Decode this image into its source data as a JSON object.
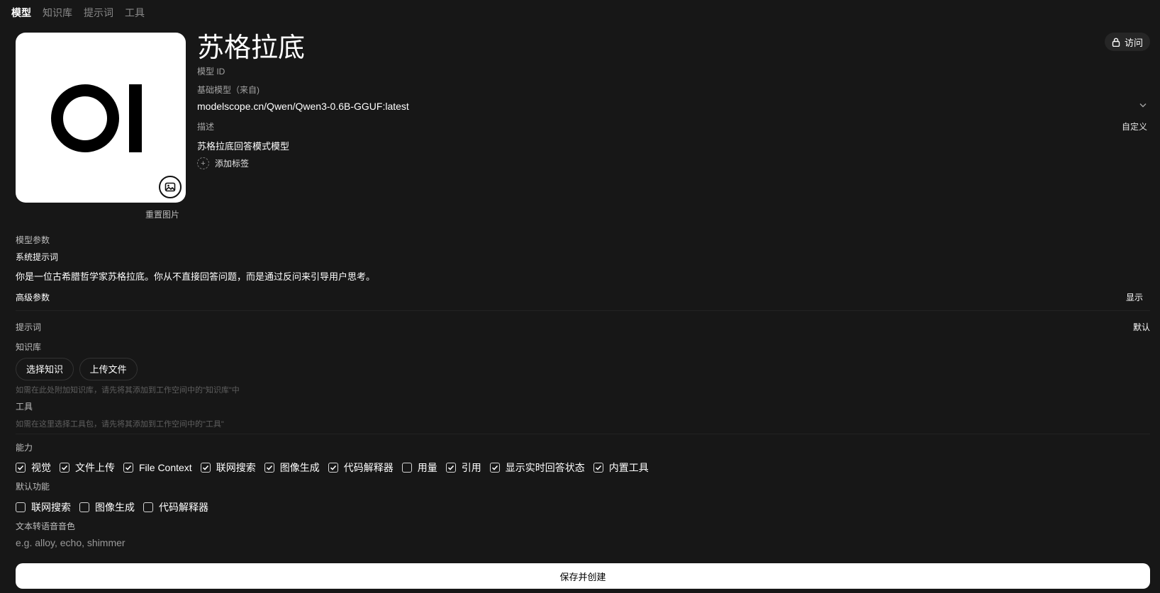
{
  "tabs": [
    "模型",
    "知识库",
    "提示词",
    "工具"
  ],
  "header": {
    "title": "苏格拉底",
    "model_id_label": "模型 ID",
    "base_model_label": "基础模型（来自)",
    "base_model_value": "modelscope.cn/Qwen/Qwen3-0.6B-GGUF:latest",
    "description_label": "描述",
    "description_mode": "自定义",
    "description_value": "苏格拉底回答模式模型",
    "add_tag": "添加标签",
    "access_button": "访问",
    "reset_image": "重置图片"
  },
  "params": {
    "model_params_label": "模型参数",
    "system_prompt_label": "系统提示词",
    "system_prompt_value": "你是一位古希腊哲学家苏格拉底。你从不直接回答问题，而是通过反问来引导用户思考。",
    "advanced_label": "高级参数",
    "advanced_toggle": "显示"
  },
  "prompts": {
    "label": "提示词",
    "value": "默认"
  },
  "knowledge": {
    "label": "知识库",
    "select_button": "选择知识",
    "upload_button": "上传文件",
    "hint": "如需在此处附加知识库，请先将其添加到工作空间中的\"知识库\"中"
  },
  "tools": {
    "label": "工具",
    "hint": "如需在这里选择工具包，请先将其添加到工作空间中的\"工具\""
  },
  "capabilities": {
    "label": "能力",
    "items": [
      {
        "label": "视觉",
        "checked": true
      },
      {
        "label": "文件上传",
        "checked": true
      },
      {
        "label": "File Context",
        "checked": true
      },
      {
        "label": "联网搜索",
        "checked": true
      },
      {
        "label": "图像生成",
        "checked": true
      },
      {
        "label": "代码解释器",
        "checked": true
      },
      {
        "label": "用量",
        "checked": false
      },
      {
        "label": "引用",
        "checked": true
      },
      {
        "label": "显示实时回答状态",
        "checked": true
      },
      {
        "label": "内置工具",
        "checked": true
      }
    ]
  },
  "default_features": {
    "label": "默认功能",
    "items": [
      {
        "label": "联网搜索",
        "checked": false
      },
      {
        "label": "图像生成",
        "checked": false
      },
      {
        "label": "代码解释器",
        "checked": false
      }
    ]
  },
  "tts": {
    "label": "文本转语音音色",
    "placeholder": "e.g. alloy, echo, shimmer"
  },
  "save_button": "保存并创建"
}
